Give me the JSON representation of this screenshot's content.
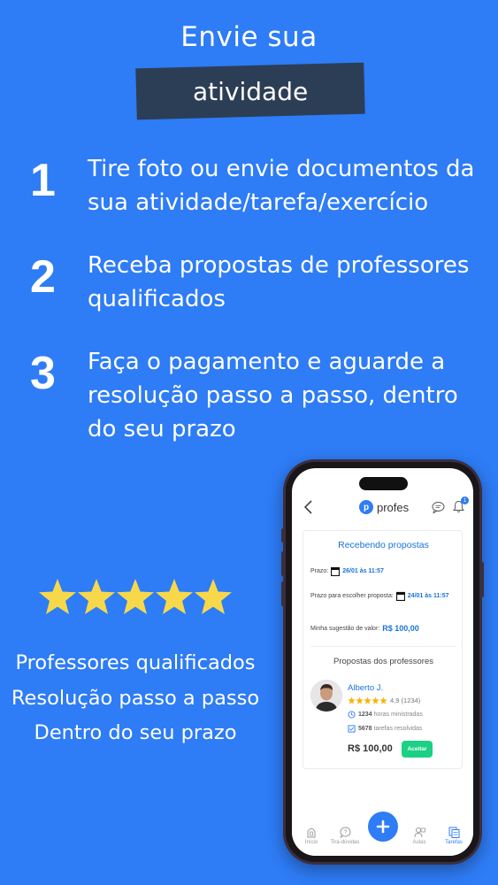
{
  "title": {
    "line1": "Envie sua",
    "line2": "atividade"
  },
  "steps": [
    {
      "number": "1",
      "text": "Tire foto ou envie documentos da sua atividade/tarefa/exercício"
    },
    {
      "number": "2",
      "text": "Receba propostas de professores qualificados"
    },
    {
      "number": "3",
      "text": "Faça o pagamento e aguarde a resolução passo a passo, dentro do seu prazo"
    }
  ],
  "rating": {
    "stars": 5,
    "color": "#f7d84a"
  },
  "features": [
    "Professores qualificados",
    "Resolução passo a passo",
    "Dentro do seu prazo"
  ],
  "phone": {
    "header": {
      "logo_letter": "p",
      "logo_text": "profes",
      "notification_count": "1"
    },
    "card": {
      "title": "Recebendo propostas",
      "prazo_label": "Prazo:",
      "prazo_value": "26/01 às 11:57",
      "choose_label": "Prazo para escolher proposta:",
      "choose_value": "24/01 às 11:57",
      "suggestion_label": "Minha sugestão de valor:",
      "suggestion_value": "R$ 100,00",
      "section_title": "Propostas dos professores",
      "professor": {
        "name": "Alberto J.",
        "rating": "4,9",
        "reviews": "(1234)",
        "hours_count": "1234",
        "hours_label": "horas ministradas",
        "tasks_count": "5678",
        "tasks_label": "tarefas resolvidas",
        "price": "R$ 100,00",
        "accept_label": "Aceitar"
      }
    },
    "tabs": [
      {
        "label": "Início",
        "icon": "home-icon"
      },
      {
        "label": "Tira-dúvidas",
        "icon": "question-icon"
      },
      {
        "label": "Aulas",
        "icon": "class-icon"
      },
      {
        "label": "Tarefas",
        "icon": "tasks-icon"
      }
    ]
  },
  "colors": {
    "background": "#2e7cf6",
    "banner": "#2c3e55",
    "accent": "#1a73d9",
    "accept": "#1ad184"
  }
}
